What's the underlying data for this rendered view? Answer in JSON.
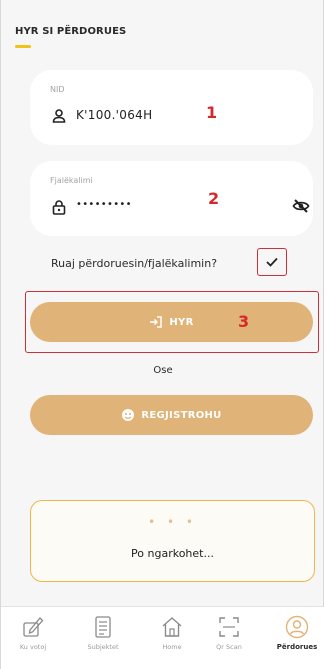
{
  "page": {
    "title": "HYR SI PËRDORUES"
  },
  "nid_field": {
    "label": "NID",
    "value": "K'100.'064H",
    "marker": "1"
  },
  "password_field": {
    "label": "Fjalëkalimi",
    "value": "•••••••••",
    "marker": "2"
  },
  "remember": {
    "label": "Ruaj përdoruesin/fjalëkalimin?",
    "checked": true
  },
  "login_button": {
    "label": "HYR",
    "marker": "3"
  },
  "or_text": "Ose",
  "register_button": {
    "label": "REGJISTROHU"
  },
  "loading": {
    "dots": "• • •",
    "text": "Po ngarkohet..."
  },
  "bottom_nav": {
    "items": [
      {
        "label": "Ku votoj",
        "icon": "ballot-pen-icon"
      },
      {
        "label": "Subjektet",
        "icon": "list-document-icon"
      },
      {
        "label": "Home",
        "icon": "home-icon"
      },
      {
        "label": "Qr Scan",
        "icon": "qr-scan-icon"
      },
      {
        "label": "Përdorues",
        "icon": "user-icon",
        "active": true
      }
    ]
  },
  "colors": {
    "accent": "#e0b378",
    "title_underline": "#f0c318",
    "highlight_frame": "#c9303a",
    "marker": "#d62828",
    "loading_border": "#f1b54c",
    "active_nav": "#e0b378"
  }
}
